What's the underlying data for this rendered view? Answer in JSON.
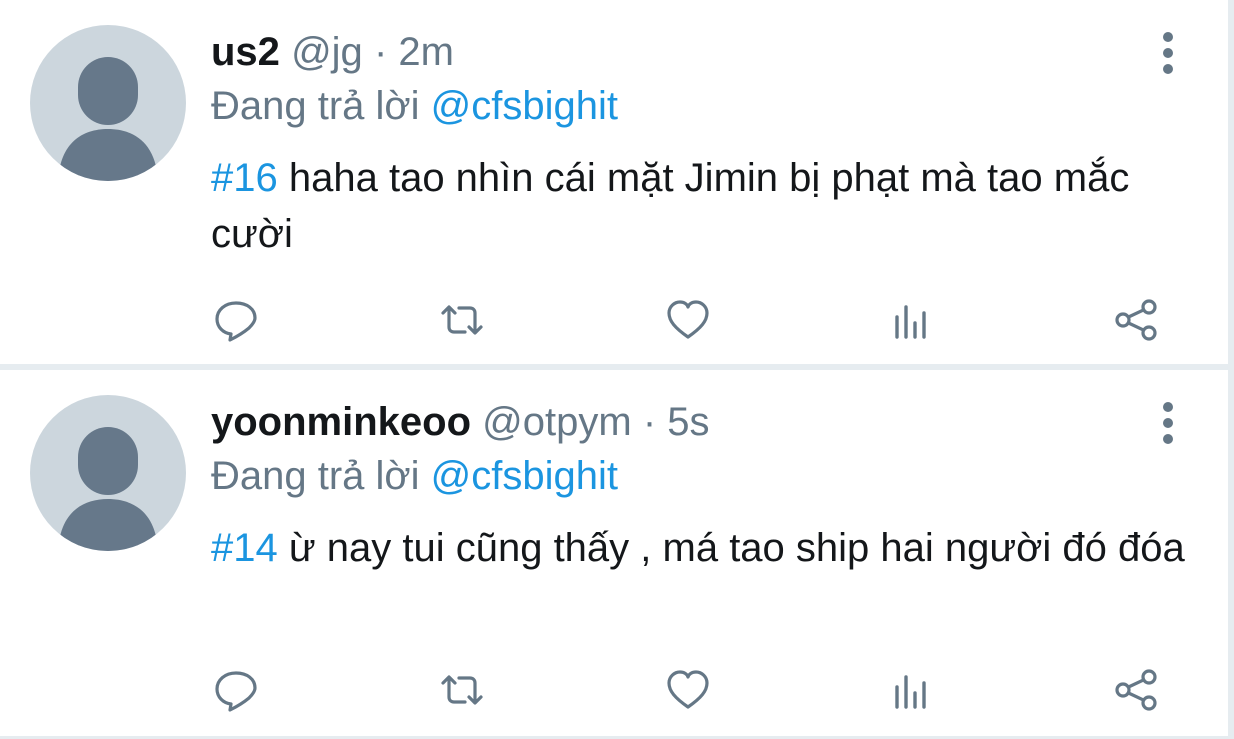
{
  "tweets": [
    {
      "name": "us2",
      "handle": "@jg",
      "separator": "·",
      "time": "2m",
      "replying_label": "Đang trả lời",
      "replying_to": "@cfsbighit",
      "hashtag": "#16",
      "text": " haha tao nhìn cái mặt Jimin bị phạt mà tao mắc cười"
    },
    {
      "name": "yoonminkeoo",
      "handle": "@otpym",
      "separator": "·",
      "time": "5s",
      "replying_label": "Đang trả lời",
      "replying_to": "@cfsbighit",
      "hashtag": "#14",
      "text": " ừ nay tui cũng thấy , má tao ship hai người đó đóa"
    }
  ],
  "icons": {
    "reply": "reply-icon",
    "retweet": "retweet-icon",
    "like": "like-icon",
    "stats": "stats-icon",
    "share": "share-icon",
    "more": "more-vertical-icon",
    "avatar": "default-avatar-icon"
  },
  "colors": {
    "link": "#1b95e0",
    "secondary": "#657786",
    "primary_text": "#14171a",
    "avatar_bg": "#ccd6dd",
    "avatar_fg": "#66788a",
    "divider": "#e6ecf0"
  }
}
